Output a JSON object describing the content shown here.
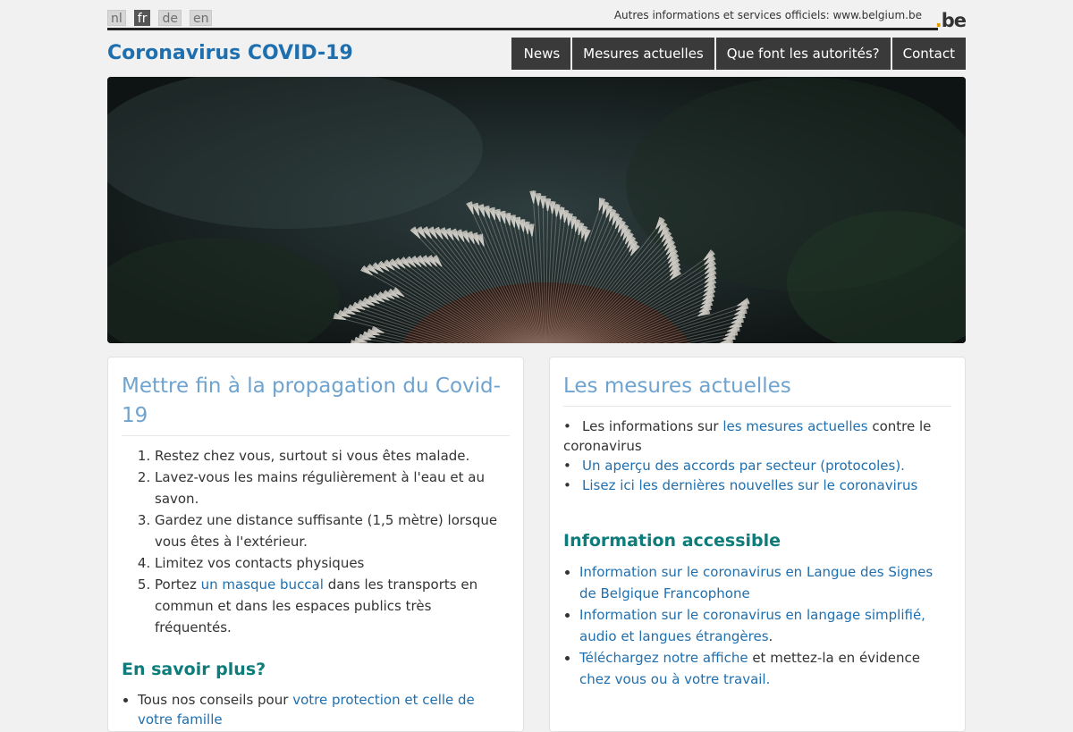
{
  "languages": [
    {
      "code": "nl",
      "active": false
    },
    {
      "code": "fr",
      "active": true
    },
    {
      "code": "de",
      "active": false
    },
    {
      "code": "en",
      "active": false
    }
  ],
  "official_text": "Autres informations et services officiels: www.belgium.be",
  "logo": {
    "prefix": ".",
    "text": "be"
  },
  "site_title": "Coronavirus COVID-19",
  "nav": [
    "News",
    "Mesures actuelles",
    "Que font les autorités?",
    "Contact"
  ],
  "hero": {
    "icon": "dandelion-photo"
  },
  "left": {
    "title": "Mettre fin à la propagation du Covid-19",
    "advice": {
      "i1": "Restez chez vous, surtout si vous êtes malade.",
      "i2": "Lavez-vous les mains régulièrement à l'eau et au savon.",
      "i3": "Gardez une distance suffisante (1,5 mètre) lorsque vous êtes à l'extérieur.",
      "i4": "Limitez vos contacts physiques",
      "i5_before": "Portez ",
      "i5_link": "un masque buccal",
      "i5_after": " dans les transports en commun et dans les espaces publics très fréquentés."
    },
    "more_title": "En savoir plus?",
    "more_before": "Tous nos conseils pour ",
    "more_link": "votre protection et celle de votre famille"
  },
  "right": {
    "title": "Les mesures actuelles",
    "m1_before": "Les informations sur ",
    "m1_link": "les mesures actuelles",
    "m1_after": " contre le coronavirus",
    "m2_link": "Un aperçu des accords par secteur (protocoles).",
    "m3_link": "Lisez ici les dernières nouvelles sur le coronavirus",
    "access_title": "Information accessible",
    "a1_link": "Information sur le coronavirus en Langue des Signes de Belgique Francophone",
    "a2_link": "Information sur le coronavirus en langage simplifié, audio et langues étrangères",
    "a2_after": ".",
    "a3_link1": "Téléchargez  notre affiche",
    "a3_mid": "  et mettez-la en évidence",
    "a3_link2": "chez vous ou à votre travail."
  },
  "colors": {
    "title_blue": "#1f6fae",
    "panel_title": "#6fa3cf",
    "teal": "#0e7c7b",
    "nav_bg": "#3a3a3a"
  }
}
